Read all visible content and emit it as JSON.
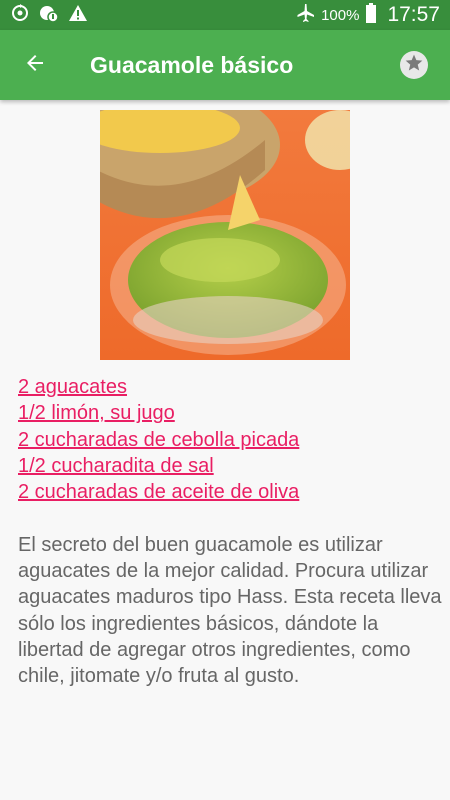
{
  "status_bar": {
    "battery": "100%",
    "time": "17:57",
    "icons": [
      "sync-icon",
      "notification-icon",
      "warning-icon",
      "airplane-icon",
      "battery-icon"
    ]
  },
  "app_bar": {
    "title": "Guacamole básico",
    "back_icon": "arrow-back-icon",
    "favorite_icon": "star-icon"
  },
  "recipe": {
    "image": "guacamole-photo",
    "ingredients": [
      "2 aguacates",
      "1/2 limón, su jugo",
      "2 cucharadas de cebolla picada",
      "1/2 cucharadita de sal",
      "2 cucharadas de aceite de oliva"
    ],
    "description": "El secreto del buen guacamole es utilizar aguacates de la mejor calidad. Procura utilizar aguacates maduros tipo Hass. Esta receta lleva sólo los ingredientes básicos, dándote la libertad de agregar otros ingredientes, como chile, jitomate y/o fruta al gusto."
  },
  "colors": {
    "status_bar": "#388e3c",
    "app_bar": "#4caf50",
    "ingredient_link": "#e91e63",
    "body_text": "#666666",
    "background": "#f8f8f8"
  }
}
